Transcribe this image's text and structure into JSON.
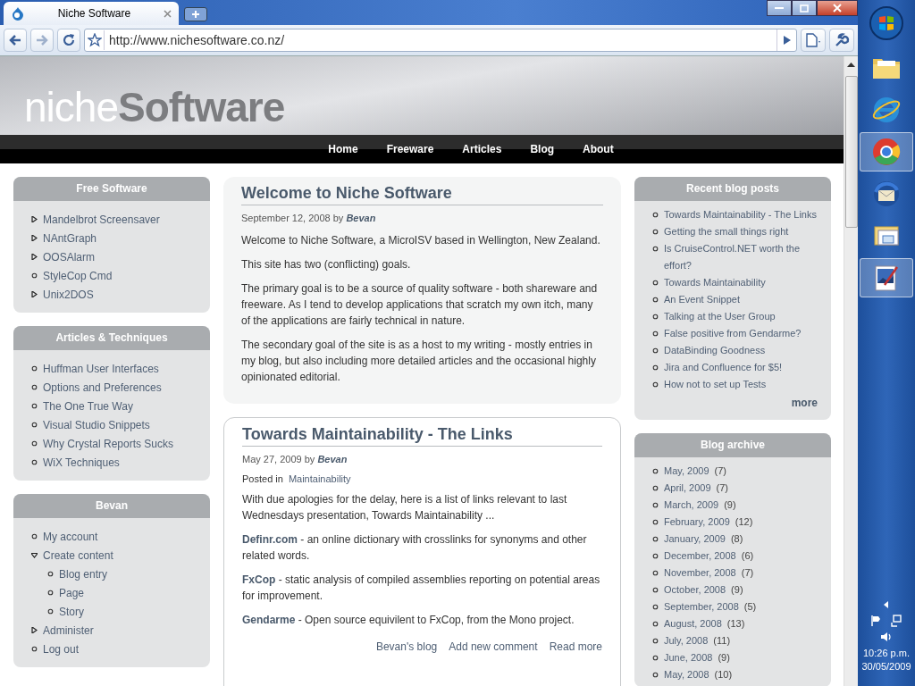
{
  "browser": {
    "tab": {
      "title": "Niche Software",
      "selected": true
    },
    "address": "http://www.nichesoftware.co.nz/"
  },
  "site": {
    "logo": "niche**Software**",
    "nav": [
      {
        "label": "Home"
      },
      {
        "label": "Freeware"
      },
      {
        "label": "Articles"
      },
      {
        "label": "Blog"
      },
      {
        "label": "About"
      }
    ]
  },
  "left_sidebar": [
    {
      "title": "Free Software",
      "items": [
        {
          "label": "Mandelbrot Screensaver",
          "kind": "collapsed"
        },
        {
          "label": "NAntGraph",
          "kind": "collapsed"
        },
        {
          "label": "OOSAlarm",
          "kind": "collapsed"
        },
        {
          "label": "StyleCop Cmd",
          "kind": "leaf"
        },
        {
          "label": "Unix2DOS",
          "kind": "collapsed"
        }
      ]
    },
    {
      "title": "Articles & Techniques",
      "items": [
        {
          "label": "Huffman User Interfaces",
          "kind": "leaf"
        },
        {
          "label": "Options and Preferences",
          "kind": "leaf"
        },
        {
          "label": "The One True Way",
          "kind": "leaf"
        },
        {
          "label": "Visual Studio Snippets",
          "kind": "leaf"
        },
        {
          "label": "Why Crystal Reports Sucks",
          "kind": "leaf"
        },
        {
          "label": "WiX Techniques",
          "kind": "leaf"
        }
      ]
    },
    {
      "title": "Bevan",
      "items": [
        {
          "label": "My account",
          "kind": "leaf"
        },
        {
          "label": "Create content",
          "kind": "expanded",
          "children": [
            {
              "label": "Blog entry",
              "kind": "leaf"
            },
            {
              "label": "Page",
              "kind": "leaf"
            },
            {
              "label": "Story",
              "kind": "leaf"
            }
          ]
        },
        {
          "label": "Administer",
          "kind": "collapsed"
        },
        {
          "label": "Log out",
          "kind": "leaf"
        }
      ]
    }
  ],
  "posts": [
    {
      "kind": "sticky",
      "title": "Welcome to Niche Software",
      "date": "September 12, 2008 by",
      "author": "Bevan",
      "paragraphs": [
        {
          "text": "Welcome to Niche Software, a MicroISV based in Wellington, New Zealand."
        },
        {
          "text": "This site has two (conflicting) goals."
        },
        {
          "text": "The primary goal is to be a source of quality software - both shareware and freeware. As I tend to develop applications that scratch my own itch, many of the applications are fairly technical in nature."
        },
        {
          "text": "The secondary goal of the site is as a host to my writing - mostly entries in my blog, but also including more detailed articles and the occasional highly opinionated editorial."
        }
      ]
    },
    {
      "kind": "teaser",
      "title": "Towards Maintainability - The Links",
      "date": "May 27, 2009 by",
      "author": "Bevan",
      "posted_in": "Posted in",
      "term": "Maintainability",
      "paragraphs": [
        {
          "text": "With due apologies for the delay, here is a list of links relevant to last Wednesdays presentation, Towards Maintainability ..."
        },
        {
          "link": "Definr.com",
          "text": " - an online dictionary with crosslinks for synonyms and other related words."
        },
        {
          "link": "FxCop",
          "text": " - static analysis of compiled assemblies reporting on potential areas for improvement."
        },
        {
          "link": "Gendarme",
          "text": " - Open source equivilent to FxCop, from the Mono project."
        }
      ],
      "links": [
        "Bevan's blog",
        "Add new comment",
        "Read more"
      ]
    }
  ],
  "recent_posts": {
    "title": "Recent blog posts",
    "items": [
      "Towards Maintainability - The Links",
      "Getting the small things right",
      "Is CruiseControl.NET worth the effort?",
      "Towards Maintainability",
      "An Event Snippet",
      "Talking at the User Group",
      "False positive from Gendarme?",
      "DataBinding Goodness",
      "Jira and Confluence for $5!",
      "How not to set up Tests"
    ],
    "more": "more"
  },
  "blog_archive": {
    "title": "Blog archive",
    "items": [
      {
        "month": "May, 2009",
        "count": "(7)"
      },
      {
        "month": "April, 2009",
        "count": "(7)"
      },
      {
        "month": "March, 2009",
        "count": "(9)"
      },
      {
        "month": "February, 2009",
        "count": "(12)"
      },
      {
        "month": "January, 2009",
        "count": "(8)"
      },
      {
        "month": "December, 2008",
        "count": "(6)"
      },
      {
        "month": "November, 2008",
        "count": "(7)"
      },
      {
        "month": "October, 2008",
        "count": "(9)"
      },
      {
        "month": "September, 2008",
        "count": "(5)"
      },
      {
        "month": "August, 2008",
        "count": "(13)"
      },
      {
        "month": "July, 2008",
        "count": "(11)"
      },
      {
        "month": "June, 2008",
        "count": "(9)"
      },
      {
        "month": "May, 2008",
        "count": "(10)"
      }
    ]
  },
  "taskbar": {
    "apps": [
      {
        "kind": "folder",
        "selected": false
      },
      {
        "kind": "ie",
        "selected": false
      },
      {
        "kind": "chrome",
        "selected": true
      },
      {
        "kind": "thunderbird",
        "selected": false
      },
      {
        "kind": "mail",
        "selected": false
      },
      {
        "kind": "paint",
        "selected": true
      }
    ],
    "time": "10:26 p.m.",
    "date": "30/05/2009"
  }
}
